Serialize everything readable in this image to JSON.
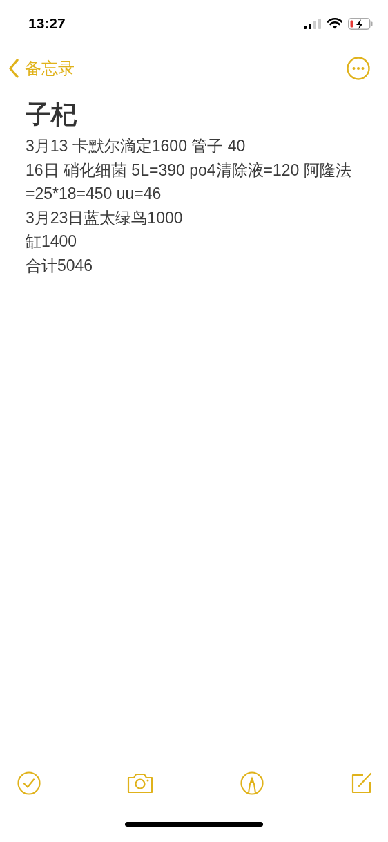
{
  "status_bar": {
    "time": "13:27"
  },
  "nav": {
    "back_label": "备忘录"
  },
  "note": {
    "title": "子杞",
    "lines": [
      "3月13 卡默尔滴定1600 管子 40",
      "16日 硝化细菌 5L=390 po4清除液=120 阿隆法=25*18=450 uu=46",
      "3月23日蓝太绿鸟1000",
      "缸1400",
      "合计5046"
    ]
  }
}
